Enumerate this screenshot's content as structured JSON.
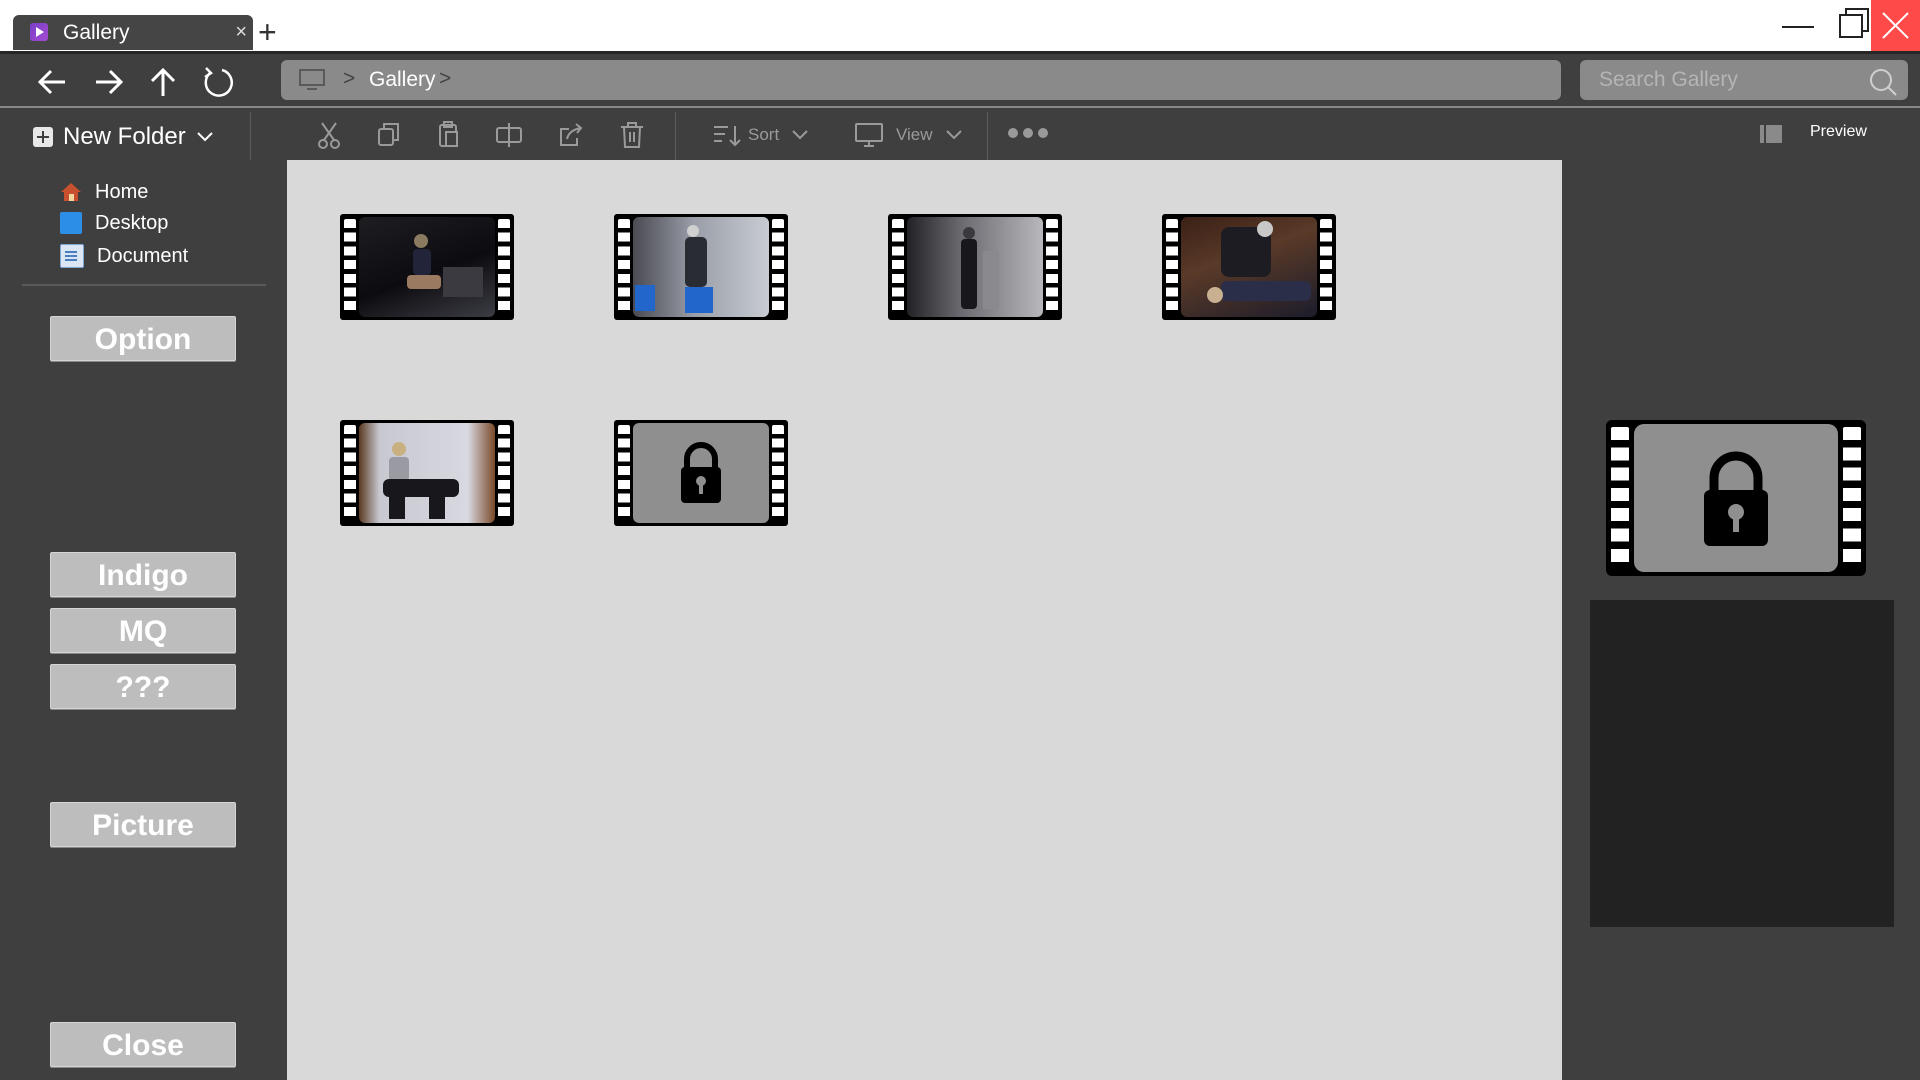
{
  "window": {
    "tab_title": "Gallery",
    "tab_close": "×",
    "new_tab": "+"
  },
  "address": {
    "breadcrumb": "Gallery",
    "sep": ">",
    "search_placeholder": "Search Gallery"
  },
  "toolbar": {
    "new_folder": "New Folder",
    "sort": "Sort",
    "view": "View",
    "preview": "Preview"
  },
  "sidebar": {
    "quick_access": [
      {
        "label": "Home",
        "icon": "home-icon"
      },
      {
        "label": "Desktop",
        "icon": "desktop-icon"
      },
      {
        "label": "Document",
        "icon": "document-icon"
      }
    ],
    "buttons": {
      "option": "Option",
      "indigo": "Indigo",
      "mq": "MQ",
      "unknown": "???",
      "picture": "Picture",
      "close": "Close"
    }
  },
  "gallery": {
    "items": [
      {
        "type": "video",
        "locked": false
      },
      {
        "type": "video",
        "locked": false
      },
      {
        "type": "video",
        "locked": false
      },
      {
        "type": "video",
        "locked": false
      },
      {
        "type": "video",
        "locked": false
      },
      {
        "type": "video",
        "locked": true
      }
    ]
  },
  "preview": {
    "locked": true
  },
  "colors": {
    "accent_close": "#ff4a4a",
    "main_bg": "#d9d9d9",
    "chrome_bg": "#3f3f3f",
    "button_bg": "#bdbdbd"
  }
}
